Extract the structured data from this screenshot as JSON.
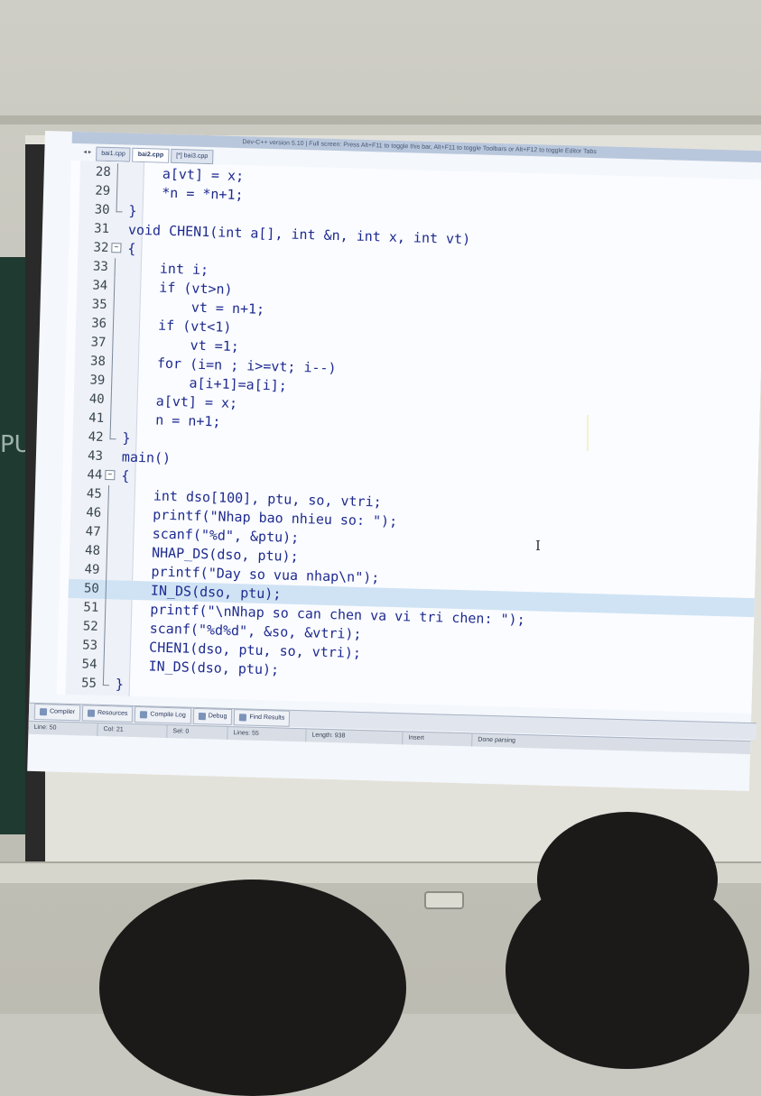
{
  "window": {
    "title": "Dev-C++ version 5.10 | Full screen: Press Alt+F11 to toggle this bar, Alt+F11 to toggle Toolbars or Alt+F12 to toggle Editor Tabs"
  },
  "tabs": [
    {
      "label": "bai1.cpp",
      "active": false
    },
    {
      "label": "bai2.cpp",
      "active": true
    },
    {
      "label": "[*] bai3.cpp",
      "active": false
    }
  ],
  "tab_nav": "◂ ▸",
  "editor": {
    "current_line": 50,
    "lines": [
      {
        "n": "28",
        "text": "    a[vt] = x;"
      },
      {
        "n": "29",
        "text": "    *n = *n+1;"
      },
      {
        "n": "30",
        "text": "}"
      },
      {
        "n": "31",
        "text": "void CHEN1(int a[], int &n, int x, int vt)"
      },
      {
        "n": "32",
        "text": "{"
      },
      {
        "n": "33",
        "text": "    int i;"
      },
      {
        "n": "34",
        "text": "    if (vt>n)"
      },
      {
        "n": "35",
        "text": "        vt = n+1;"
      },
      {
        "n": "36",
        "text": "    if (vt<1)"
      },
      {
        "n": "37",
        "text": "        vt =1;"
      },
      {
        "n": "38",
        "text": "    for (i=n ; i>=vt; i--)"
      },
      {
        "n": "39",
        "text": "        a[i+1]=a[i];"
      },
      {
        "n": "40",
        "text": "    a[vt] = x;"
      },
      {
        "n": "41",
        "text": "    n = n+1;"
      },
      {
        "n": "42",
        "text": "}"
      },
      {
        "n": "43",
        "text": "main()"
      },
      {
        "n": "44",
        "text": "{"
      },
      {
        "n": "45",
        "text": "    int dso[100], ptu, so, vtri;"
      },
      {
        "n": "46",
        "text": "    printf(\"Nhap bao nhieu so: \");"
      },
      {
        "n": "47",
        "text": "    scanf(\"%d\", &ptu);"
      },
      {
        "n": "48",
        "text": "    NHAP_DS(dso, ptu);"
      },
      {
        "n": "49",
        "text": "    printf(\"Day so vua nhap\\n\");"
      },
      {
        "n": "50",
        "text": "    IN_DS(dso, ptu);"
      },
      {
        "n": "51",
        "text": "    printf(\"\\nNhap so can chen va vi tri chen: \");"
      },
      {
        "n": "52",
        "text": "    scanf(\"%d%d\", &so, &vtri);"
      },
      {
        "n": "53",
        "text": "    CHEN1(dso, ptu, so, vtri);"
      },
      {
        "n": "54",
        "text": "    IN_DS(dso, ptu);"
      },
      {
        "n": "55",
        "text": "}"
      }
    ]
  },
  "bottom_tabs": [
    {
      "label": "Compiler",
      "icon": "compiler-icon"
    },
    {
      "label": "Resources",
      "icon": "resources-icon"
    },
    {
      "label": "Compile Log",
      "icon": "compile-log-icon"
    },
    {
      "label": "Debug",
      "icon": "debug-icon"
    },
    {
      "label": "Find Results",
      "icon": "find-results-icon"
    }
  ],
  "status": {
    "line": "Line: 50",
    "col": "Col: 21",
    "sel": "Sel: 0",
    "lines": "Lines: 55",
    "length": "Length: 938",
    "mode": "Insert",
    "message": "Done parsing"
  },
  "colors": {
    "code": "#1d2a8f",
    "string": "#1b2cc2",
    "current_line": "#cfe3f4",
    "board": "#1f3a31"
  },
  "board_text": "PU"
}
